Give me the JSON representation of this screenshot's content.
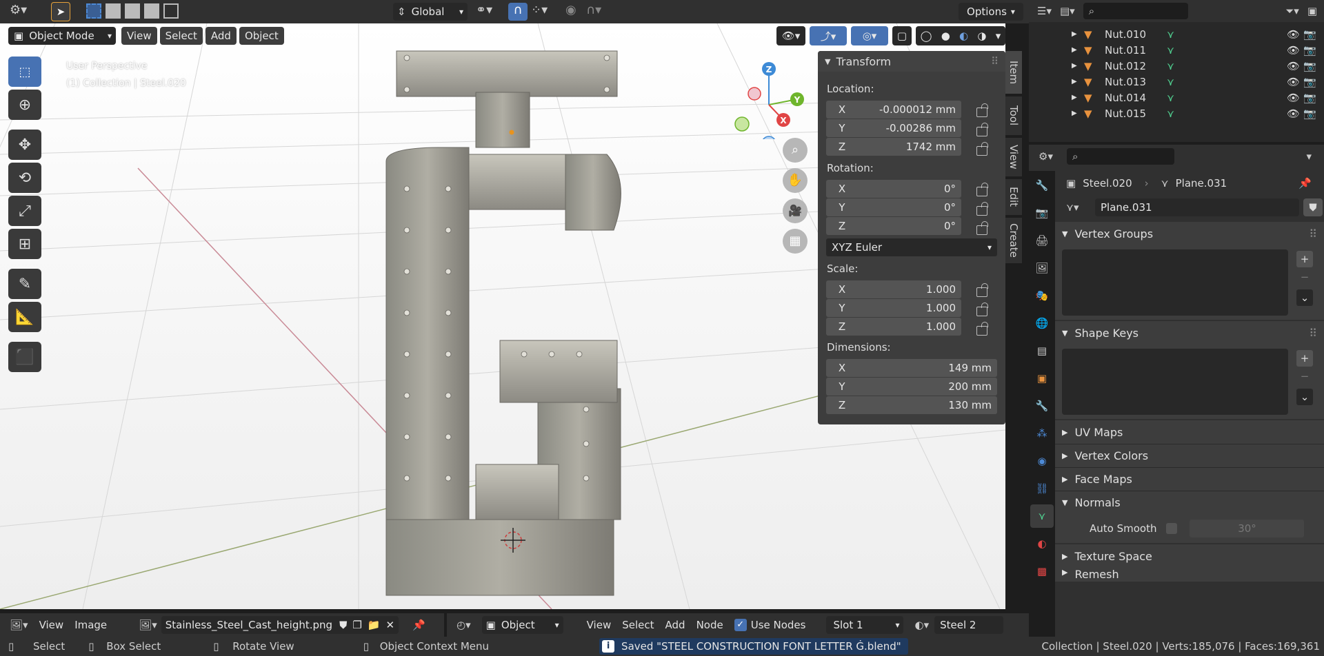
{
  "topbar": {
    "orientation": "Global",
    "options": "Options"
  },
  "viewport_header": {
    "mode": "Object Mode",
    "menus": [
      "View",
      "Select",
      "Add",
      "Object"
    ]
  },
  "viewport": {
    "overlay_line1": "User Perspective",
    "overlay_line2": "(1) Collection | Steel.020",
    "gizmo": {
      "x": "X",
      "y": "Y",
      "z": "Z"
    }
  },
  "transform": {
    "title": "Transform",
    "location_label": "Location:",
    "location": [
      {
        "axis": "X",
        "value": "-0.000012 mm"
      },
      {
        "axis": "Y",
        "value": "-0.00286 mm"
      },
      {
        "axis": "Z",
        "value": "1742 mm"
      }
    ],
    "rotation_label": "Rotation:",
    "rotation": [
      {
        "axis": "X",
        "value": "0°"
      },
      {
        "axis": "Y",
        "value": "0°"
      },
      {
        "axis": "Z",
        "value": "0°"
      }
    ],
    "rotation_mode": "XYZ Euler",
    "scale_label": "Scale:",
    "scale": [
      {
        "axis": "X",
        "value": "1.000"
      },
      {
        "axis": "Y",
        "value": "1.000"
      },
      {
        "axis": "Z",
        "value": "1.000"
      }
    ],
    "dimensions_label": "Dimensions:",
    "dimensions": [
      {
        "axis": "X",
        "value": "149 mm"
      },
      {
        "axis": "Y",
        "value": "200 mm"
      },
      {
        "axis": "Z",
        "value": "130 mm"
      }
    ]
  },
  "sidebar_tabs": [
    "Item",
    "Tool",
    "View",
    "Edit",
    "Create"
  ],
  "outliner": {
    "items": [
      "Nut.010",
      "Nut.011",
      "Nut.012",
      "Nut.013",
      "Nut.014",
      "Nut.015"
    ]
  },
  "properties": {
    "object_name": "Steel.020",
    "mesh_name": "Plane.031",
    "mesh_field": "Plane.031",
    "panels": {
      "vertex_groups": "Vertex Groups",
      "shape_keys": "Shape Keys",
      "uv_maps": "UV Maps",
      "vertex_colors": "Vertex Colors",
      "face_maps": "Face Maps",
      "normals": "Normals",
      "auto_smooth": "Auto Smooth",
      "auto_smooth_angle": "30°",
      "texture_space": "Texture Space",
      "remesh": "Remesh"
    }
  },
  "image_editor_header": {
    "menus": [
      "View",
      "Image"
    ],
    "image_name": "Stainless_Steel_Cast_height.png"
  },
  "node_editor_header": {
    "object": "Object",
    "menus": [
      "View",
      "Select",
      "Add",
      "Node"
    ],
    "use_nodes": "Use Nodes",
    "slot": "Slot 1",
    "material": "Steel 2"
  },
  "statusbar": {
    "select": "Select",
    "box_select": "Box Select",
    "rotate_view": "Rotate View",
    "context_menu": "Object Context Menu",
    "saved_message": "Saved \"STEEL CONSTRUCTION FONT LETTER Ġ.blend\"",
    "stats": "Collection | Steel.020 | Verts:185,076 | Faces:169,361"
  }
}
